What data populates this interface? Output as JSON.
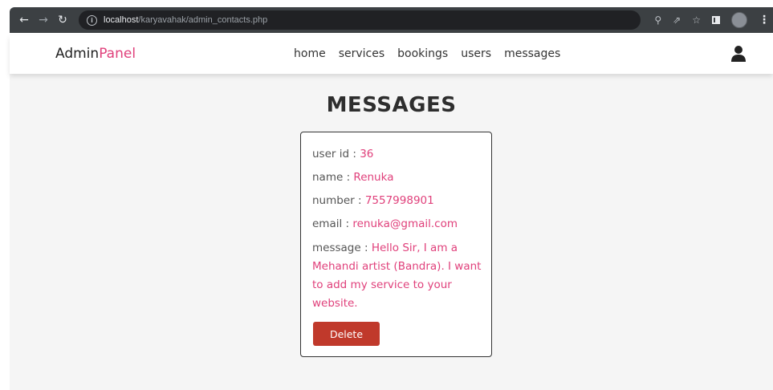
{
  "browser": {
    "url_host": "localhost",
    "url_path": "/karyavahak/admin_contacts.php"
  },
  "header": {
    "brand_main": "Admin",
    "brand_accent": "Panel",
    "nav": [
      "home",
      "services",
      "bookings",
      "users",
      "messages"
    ]
  },
  "page_title": "MESSAGES",
  "message_card": {
    "user_id_label": "user id : ",
    "user_id": "36",
    "name_label": "name : ",
    "name": "Renuka",
    "number_label": "number : ",
    "number": "7557998901",
    "email_label": "email : ",
    "email": "renuka@gmail.com",
    "message_label": "message : ",
    "message": "Hello Sir, I am a Mehandi artist (Bandra). I want to add my service to your website.",
    "delete_label": "Delete"
  },
  "colors": {
    "accent": "#e0407b",
    "delete": "#c0392b"
  }
}
